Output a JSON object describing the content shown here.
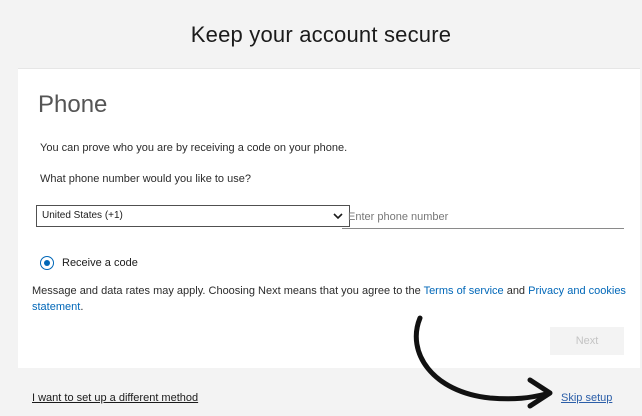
{
  "header": {
    "title": "Keep your account secure"
  },
  "phone_section": {
    "title": "Phone",
    "intro": "You can prove who you are by receiving a code on your phone.",
    "question": "What phone number would you like to use?",
    "country_select": {
      "selected": "United States (+1)"
    },
    "phone_input": {
      "value": "",
      "placeholder": "Enter phone number"
    },
    "method_radio": {
      "label": "Receive a code",
      "checked": true
    },
    "notice": {
      "prefix": "Message and data rates may apply. Choosing Next means that you agree to the ",
      "terms_link": "Terms of service",
      "middle": " and ",
      "privacy_link": "Privacy and cookies statement",
      "suffix": "."
    },
    "next_button": "Next"
  },
  "footer": {
    "alt_method_link": "I want to set up a different method",
    "skip_link": "Skip setup"
  },
  "icons": {
    "select_chevron": "chevron-down-icon",
    "annotation_arrow": "curved-arrow-icon"
  },
  "colors": {
    "accent": "#0067b8",
    "skip_link": "#2b5ea8",
    "disabled_text": "#c4c4c4",
    "page_bg": "#f3f3f3",
    "card_bg": "#ffffff"
  }
}
